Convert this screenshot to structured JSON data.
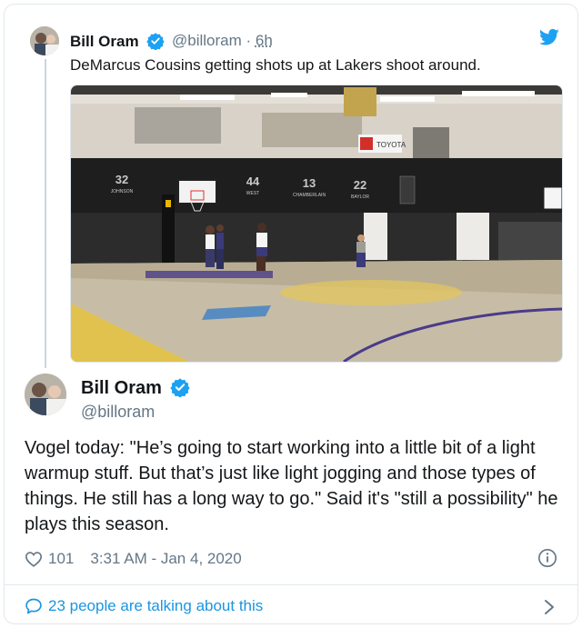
{
  "parent": {
    "name": "Bill Oram",
    "handle": "@billoram",
    "time": "6h",
    "text": "DeMarcus Cousins getting shots up at Lakers shoot around."
  },
  "media": {
    "banner_jerseys": [
      "32",
      "44",
      "13",
      "22"
    ],
    "banner_names": [
      "JOHNSON",
      "WEST",
      "CHAMBERLAIN",
      "BAYLOR"
    ],
    "sponsor": "TOYOTA"
  },
  "main": {
    "name": "Bill Oram",
    "handle": "@billoram",
    "text": "Vogel today: \"He’s going to start working into a little bit of a light warmup stuff. But that’s just like light jogging and those types of things. He still has a long way to go.\" Said it's \"still a possibility\" he plays this season.",
    "likes": "101",
    "timestamp": "3:31 AM - Jan 4, 2020"
  },
  "footer": {
    "talking": "23 people are talking about this"
  },
  "colors": {
    "accent": "#1da1f2",
    "link": "#1b95e0",
    "secondary_text": "#657786"
  }
}
